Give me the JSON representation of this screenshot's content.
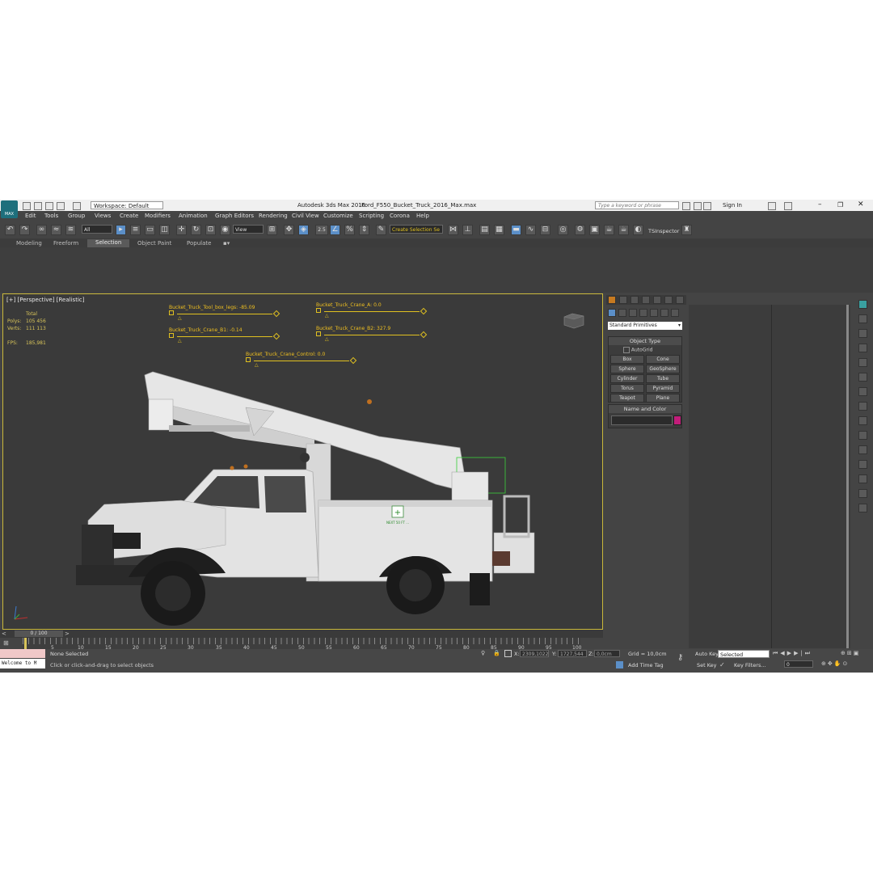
{
  "app": {
    "logo_text": "MAX",
    "title": "Autodesk 3ds Max 2016",
    "filename": "Ford_F550_Bucket_Truck_2016_Max.max",
    "workspace": "Workspace: Default",
    "search_placeholder": "Type a keyword or phrase",
    "sign_in": "Sign In"
  },
  "menu": [
    "Edit",
    "Tools",
    "Group",
    "Views",
    "Create",
    "Modifiers",
    "Animation",
    "Graph Editors",
    "Rendering",
    "Civil View",
    "Customize",
    "Scripting",
    "Corona",
    "Help"
  ],
  "toolbar": {
    "filter_value": "All",
    "refcoord_value": "View",
    "snap_label": "2.5",
    "selection_set_placeholder": "Create Selection Se",
    "tsinspector": "TSInspector"
  },
  "ribbon_tabs": [
    "Modeling",
    "Freeform",
    "Selection",
    "Object Paint",
    "Populate"
  ],
  "viewport": {
    "label": "[+] [Perspective] [Realistic]",
    "stats": {
      "total_label": "Total",
      "polys_label": "Polys:",
      "polys_value": "105 456",
      "verts_label": "Verts:",
      "verts_value": "111 113",
      "fps_label": "FPS:",
      "fps_value": "185,981"
    },
    "sliders": [
      {
        "label": "Bucket_Truck_Tool_box_legs: -85.09"
      },
      {
        "label": "Bucket_Truck_Crane_A: 0.0"
      },
      {
        "label": "Bucket_Truck_Crane_B1: -0.14"
      },
      {
        "label": "Bucket_Truck_Crane_B2: 327.9"
      },
      {
        "label": "Bucket_Truck_Crane_Control: 0.0"
      }
    ],
    "truck_sign": "NEXT 50 FT ..."
  },
  "command_panel": {
    "category": "Standard Primitives",
    "object_type_title": "Object Type",
    "autogrid": "AutoGrid",
    "buttons": [
      "Box",
      "Cone",
      "Sphere",
      "GeoSphere",
      "Cylinder",
      "Tube",
      "Torus",
      "Pyramid",
      "Teapot",
      "Plane"
    ],
    "name_color_title": "Name and Color",
    "accent_color": "#c21d7a"
  },
  "timeline": {
    "frame": "0 / 100",
    "ticks": [
      "5",
      "10",
      "15",
      "20",
      "25",
      "30",
      "35",
      "40",
      "45",
      "50",
      "55",
      "60",
      "65",
      "70",
      "75",
      "80",
      "85",
      "90",
      "95",
      "100"
    ]
  },
  "status": {
    "maxscript": "Welcome to M",
    "selection": "None Selected",
    "prompt": "Click or click-and-drag to select objects",
    "x_label": "X:",
    "x_value": "2309,1022",
    "y_label": "Y:",
    "y_value": "1727,544",
    "z_label": "Z:",
    "z_value": "0,0cm",
    "grid": "Grid = 10,0cm",
    "add_time_tag": "Add Time Tag",
    "auto_key": "Auto Key",
    "set_key": "Set Key",
    "selected": "Selected",
    "key_filters": "Key Filters...",
    "frame_value": "0"
  }
}
